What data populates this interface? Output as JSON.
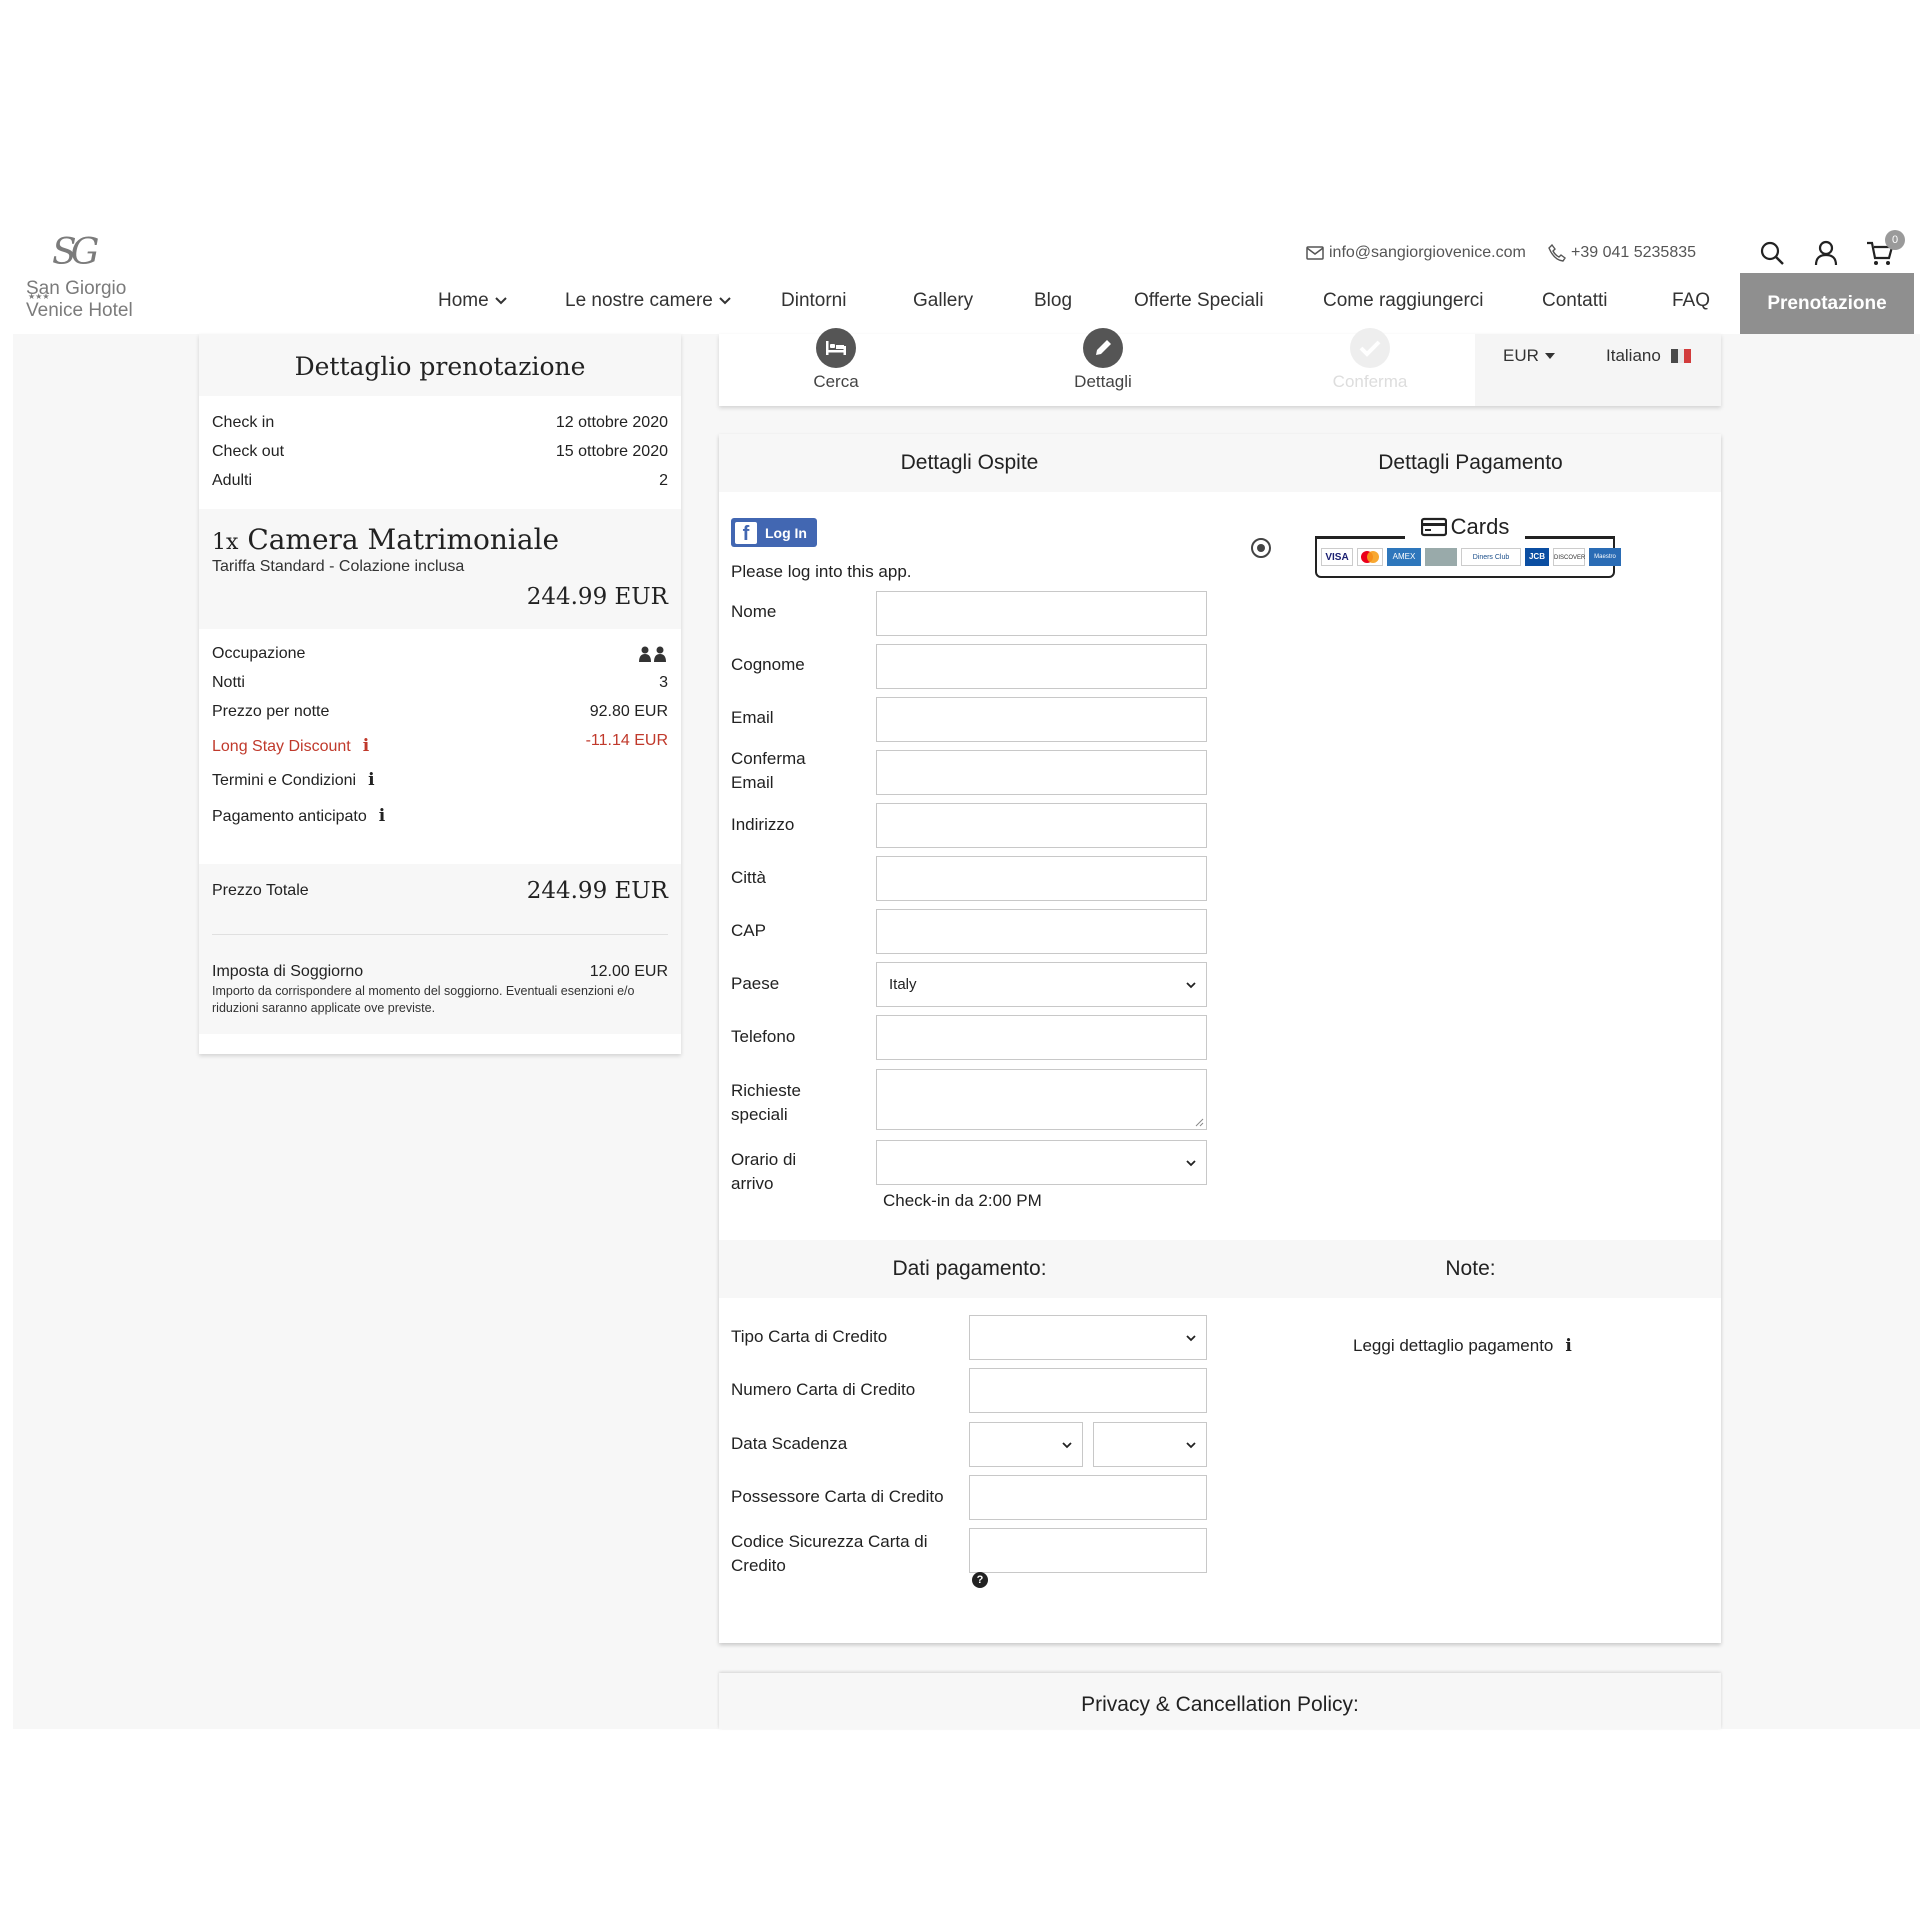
{
  "header": {
    "logo": {
      "monogram": "SG",
      "name_line1": "San Giorgio",
      "name_line2": "Venice Hotel",
      "stars": "★★★"
    },
    "contact_email": "info@sangiorgiovenice.com",
    "contact_phone": "+39 041 5235835",
    "cart_count": "0",
    "nav": [
      "Home",
      "Le nostre camere",
      "Dintorni",
      "Gallery",
      "Blog",
      "Offerte Speciali",
      "Come raggiungerci",
      "Contatti",
      "FAQ"
    ],
    "book_button": "Prenotazione",
    "icons": {
      "email": "envelope-icon",
      "phone": "phone-icon",
      "search": "search-icon",
      "account": "user-icon",
      "cart": "cart-icon"
    }
  },
  "summary": {
    "title": "Dettaglio prenotazione",
    "checkin_label": "Check in",
    "checkin_value": "12 ottobre 2020",
    "checkout_label": "Check out",
    "checkout_value": "15 ottobre 2020",
    "adults_label": "Adulti",
    "adults_value": "2",
    "room_qty": "1x",
    "room_name": "Camera Matrimoniale",
    "room_rate": "Tariffa Standard - Colazione inclusa",
    "room_price": "244.99 EUR",
    "occupancy_label": "Occupazione",
    "nights_label": "Notti",
    "nights_value": "3",
    "per_night_label": "Prezzo per notte",
    "per_night_value": "92.80 EUR",
    "discount_label": "Long Stay Discount",
    "discount_value": "-11.14 EUR",
    "terms_label": "Termini e Condizioni",
    "prepay_label": "Pagamento anticipato",
    "total_label": "Prezzo Totale",
    "total_value": "244.99 EUR",
    "tax_label": "Imposta di Soggiorno",
    "tax_value": "12.00 EUR",
    "tax_note": "Importo da corrispondere al momento del soggiorno. Eventuali esenzioni e/o riduzioni saranno applicate ove previste.",
    "discount_color": "#c0392b"
  },
  "steps": {
    "items": [
      "Cerca",
      "Dettagli",
      "Conferma"
    ],
    "currency": "EUR",
    "language": "Italiano"
  },
  "form": {
    "guest_title": "Dettagli Ospite",
    "payment_title": "Dettagli Pagamento",
    "fb_button": "Log In",
    "fb_note": "Please log into this app.",
    "fields": {
      "first_name": "Nome",
      "last_name": "Cognome",
      "email": "Email",
      "confirm_email_1": "Conferma",
      "confirm_email_2": "Email",
      "address": "Indirizzo",
      "city": "Città",
      "zip": "CAP",
      "country": "Paese",
      "country_value": "Italy",
      "phone": "Telefono",
      "requests_1": "Richieste",
      "requests_2": "speciali",
      "arrival_1": "Orario di",
      "arrival_2": "arrivo"
    },
    "checkin_note": "Check-in da 2:00 PM",
    "cards_label": "Cards",
    "card_brands": [
      "VISA",
      "MC",
      "AMEX",
      "Diners Club",
      "JCB",
      "DISCOVER",
      "Maestro"
    ],
    "pay_data_title": "Dati pagamento:",
    "notes_title": "Note:",
    "notes_link": "Leggi dettaglio pagamento",
    "cc": {
      "type": "Tipo Carta di Credito",
      "number": "Numero Carta di Credito",
      "expiry": "Data Scadenza",
      "holder": "Possessore Carta di Credito",
      "cvv_1": "Codice Sicurezza Carta di",
      "cvv_2": "Credito"
    }
  },
  "privacy_title": "Privacy & Cancellation Policy:"
}
